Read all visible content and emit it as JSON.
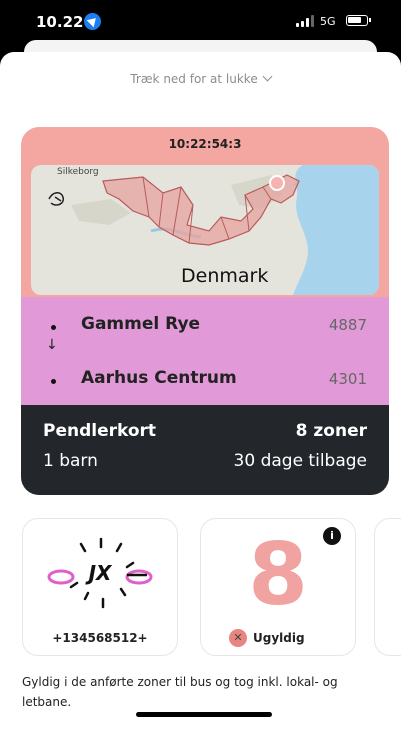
{
  "status_bar": {
    "time": "10.22",
    "network": "5G",
    "icons": [
      "location-arrow-icon",
      "signal-icon",
      "battery-icon"
    ]
  },
  "sheet": {
    "pull_hint": "Træk ned for at lukke",
    "pull_icon": "chevron-down-icon"
  },
  "ticket": {
    "timestamp": "10:22:54:3",
    "colors": {
      "header": "#f4a6a1",
      "route": "#e19ad7",
      "info": "#23262b"
    },
    "map": {
      "city_label": "Silkeborg",
      "country_label": "Denmark"
    },
    "route": {
      "from": {
        "name": "Gammel Rye",
        "zone": "4887"
      },
      "to": {
        "name": "Aarhus Centrum",
        "zone": "4301"
      },
      "direction_icon": "arrow-down-icon"
    },
    "info": {
      "type": "Pendlerkort",
      "zones": "8 zoner",
      "passenger": "1 barn",
      "remaining": "30 dage tilbage"
    }
  },
  "cards": {
    "control": {
      "code": "JX",
      "number": "+134568512+",
      "icon": "animated-control-icon"
    },
    "zones": {
      "value": "8",
      "status": "Ugyldig",
      "status_icon": "close-icon",
      "info_icon": "info-icon"
    }
  },
  "footer": {
    "validity_text": "Gyldig i de anførte zoner til bus og tog inkl. lokal- og letbane."
  }
}
